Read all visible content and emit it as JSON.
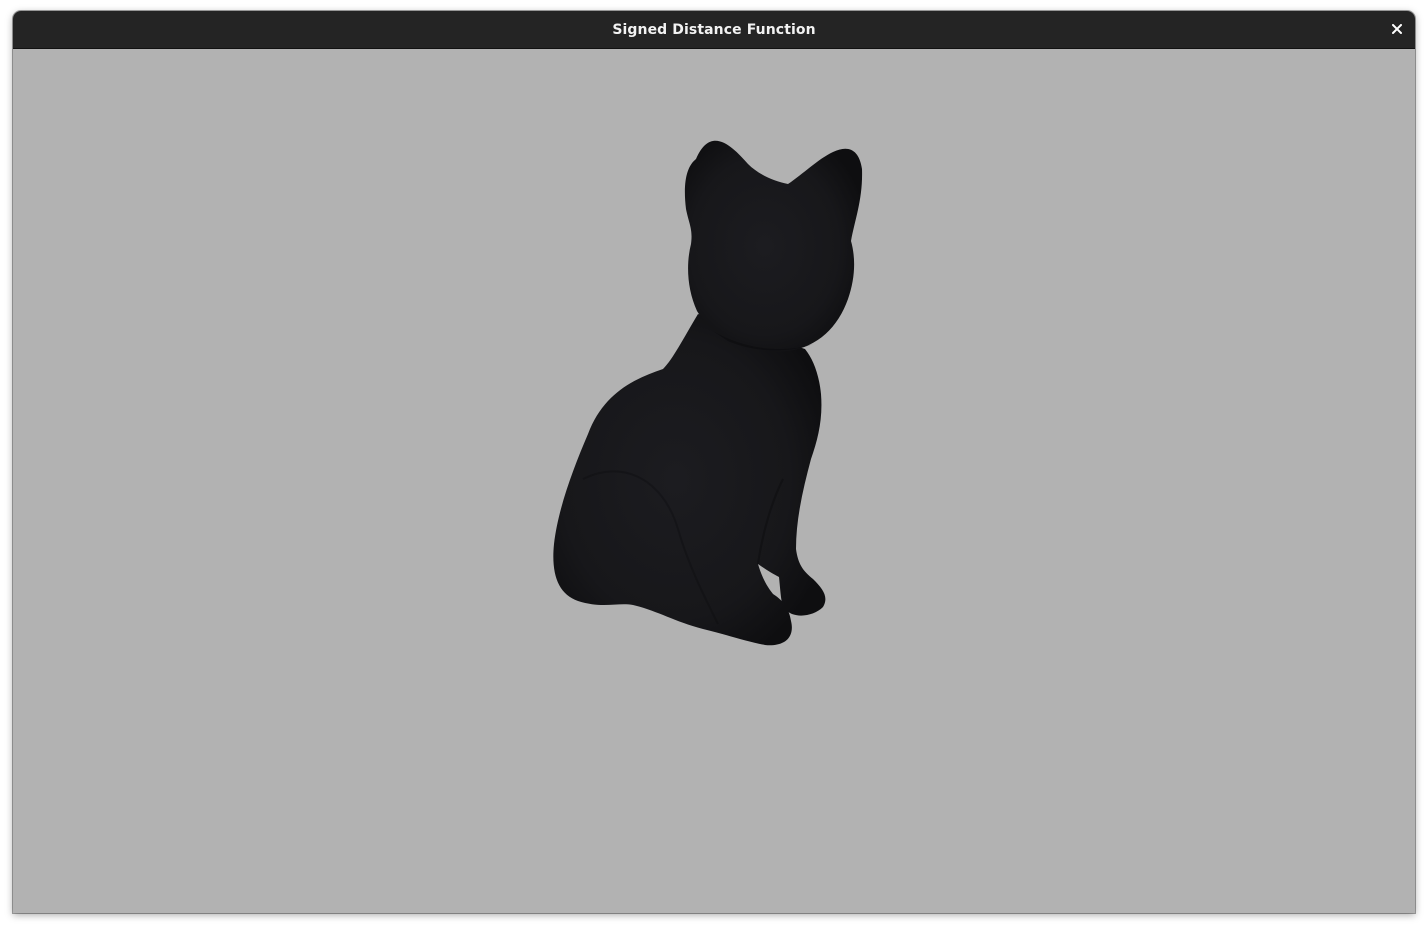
{
  "window": {
    "title": "Signed Distance Function",
    "close_icon": "close-icon"
  },
  "viewport": {
    "background_color": "#b2b2b2",
    "object_color": "#17171a",
    "object": "cat-silhouette"
  }
}
